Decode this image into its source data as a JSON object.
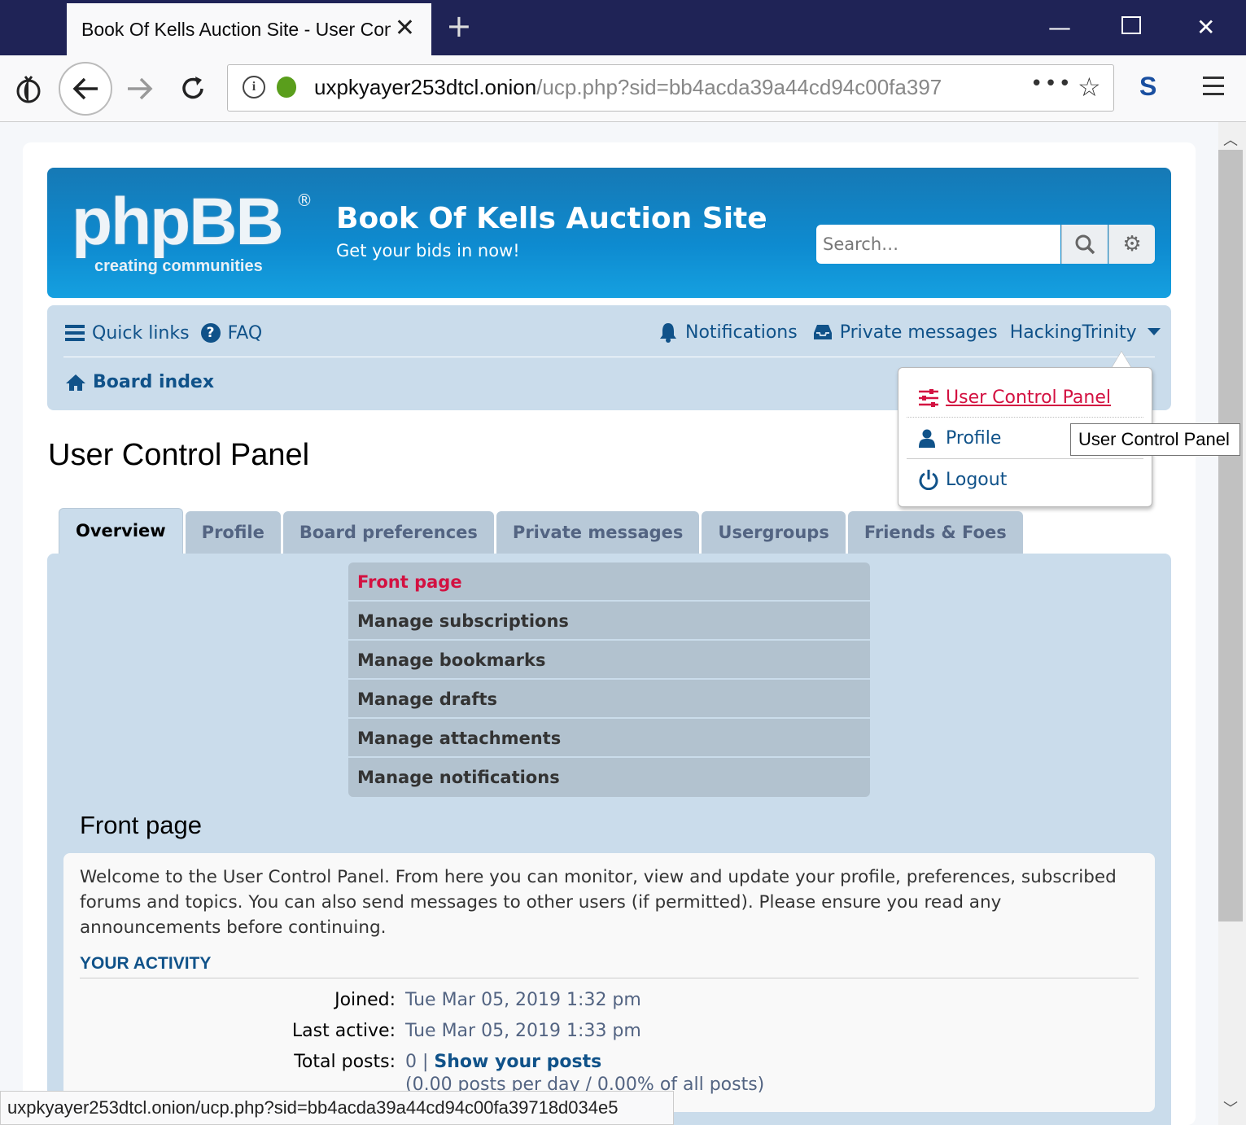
{
  "browser": {
    "tab_title": "Book Of Kells Auction Site - User Control Panel",
    "new_tab_symbol": "+",
    "url_host": "uxpkyayer253dtcl.onion",
    "url_path": "/ucp.php?sid=bb4acda39a44cd94c00fa397",
    "status_url": "uxpkyayer253dtcl.onion/ucp.php?sid=bb4acda39a44cd94c00fa39718d034e5"
  },
  "header": {
    "logo_main": "phpBB",
    "logo_sub": "creating  communities",
    "logo_reg": "®",
    "site_title": "Book Of Kells Auction Site",
    "site_desc": "Get your bids in now!",
    "search_placeholder": "Search…"
  },
  "nav": {
    "quick_links": "Quick links",
    "faq": "FAQ",
    "notifications": "Notifications",
    "private_messages": "Private messages",
    "username": "HackingTrinity",
    "board_index": "Board index"
  },
  "user_menu": {
    "items": [
      "User Control Panel",
      "Profile",
      "Logout"
    ],
    "tooltip": "User Control Panel"
  },
  "page": {
    "title": "User Control Panel",
    "tabs": [
      "Overview",
      "Profile",
      "Board preferences",
      "Private messages",
      "Usergroups",
      "Friends & Foes"
    ],
    "submenu": [
      "Front page",
      "Manage subscriptions",
      "Manage bookmarks",
      "Manage drafts",
      "Manage attachments",
      "Manage notifications"
    ],
    "section_title": "Front page",
    "welcome": "Welcome to the User Control Panel. From here you can monitor, view and update your profile, preferences, subscribed forums and topics. You can also send messages to other users (if permitted). Please ensure you read any announcements before continuing.",
    "activity_heading": "YOUR ACTIVITY",
    "joined_label": "Joined:",
    "joined_value": "Tue Mar 05, 2019 1:32 pm",
    "last_active_label": "Last active:",
    "last_active_value": "Tue Mar 05, 2019 1:33 pm",
    "total_posts_label": "Total posts:",
    "total_posts_value": "0",
    "total_posts_sep": "|",
    "show_posts": "Show your posts",
    "posts_stats": "(0.00 posts per day / 0.00% of all posts)"
  },
  "colors": {
    "link": "#105289",
    "active": "#d31141",
    "panel": "#cadceb",
    "titlebar": "#1f2356"
  }
}
